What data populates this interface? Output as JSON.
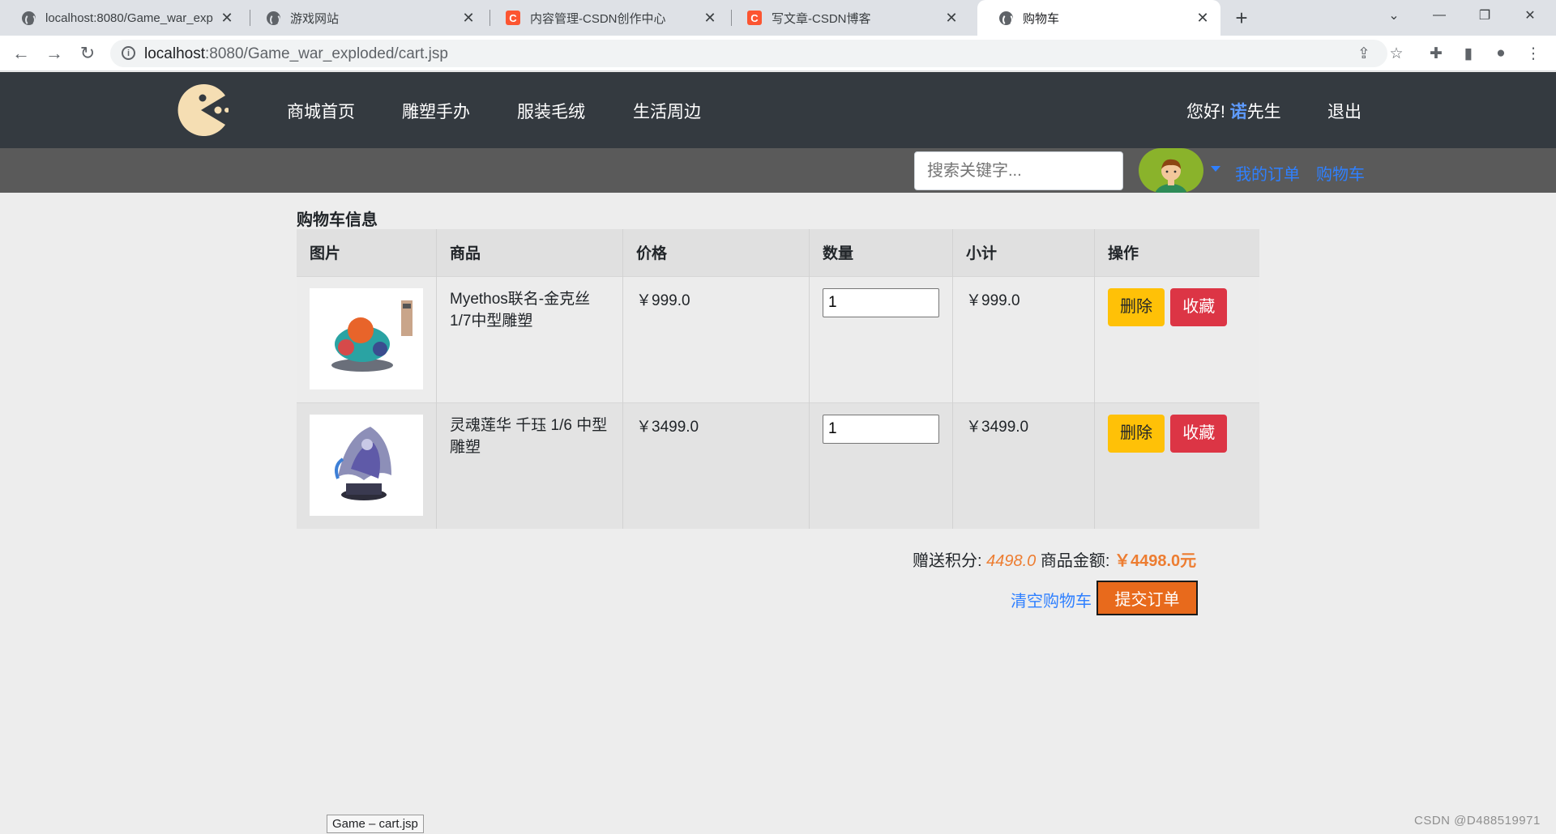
{
  "browser": {
    "tabs": [
      {
        "title": "localhost:8080/Game_war_exp",
        "icon": "globe-icon"
      },
      {
        "title": "游戏网站",
        "icon": "globe-icon"
      },
      {
        "title": "内容管理-CSDN创作中心",
        "icon": "csdn-icon"
      },
      {
        "title": "写文章-CSDN博客",
        "icon": "csdn-icon"
      },
      {
        "title": "购物车",
        "icon": "globe-icon"
      }
    ],
    "csdn_letter": "C",
    "new_tab": "+",
    "url_host": "localhost",
    "url_rest": ":8080/Game_war_exploded/cart.jsp"
  },
  "site": {
    "nav": [
      "商城首页",
      "雕塑手办",
      "服装毛绒",
      "生活周边"
    ],
    "greeting_prefix": "您好! ",
    "user_name_bold": "诺",
    "user_name_rest": "先生",
    "logout": "退出",
    "search_placeholder": "搜索关键字...",
    "my_orders": "我的订单",
    "cart_link": "购物车"
  },
  "cart": {
    "title": "购物车信息",
    "headers": [
      "图片",
      "商品",
      "价格",
      "数量",
      "小计",
      "操作"
    ],
    "items": [
      {
        "name": "Myethos联名-金克丝1/7中型雕塑",
        "price": "￥999.0",
        "qty": "1",
        "subtotal": "￥999.0",
        "delete": "删除",
        "favorite": "收藏"
      },
      {
        "name": "灵魂莲华 千珏 1/6 中型雕塑",
        "price": "￥3499.0",
        "qty": "1",
        "subtotal": "￥3499.0",
        "delete": "删除",
        "favorite": "收藏"
      }
    ],
    "points_label": "赠送积分: ",
    "points_value": "4498.0",
    "amount_label": "商品金额: ",
    "amount_value": "￥4498.0元",
    "clear": "清空购物车",
    "submit": "提交订单"
  },
  "status_tip": "Game – cart.jsp",
  "watermark": "CSDN @D488519971",
  "colors": {
    "nav_bg": "#343a40",
    "subbar_bg": "#5a5a5a",
    "accent_orange": "#ed7d31",
    "link_blue": "#2f80ff",
    "delete_yellow": "#ffc107",
    "favorite_red": "#dc3545",
    "submit_orange": "#e86a1c"
  }
}
